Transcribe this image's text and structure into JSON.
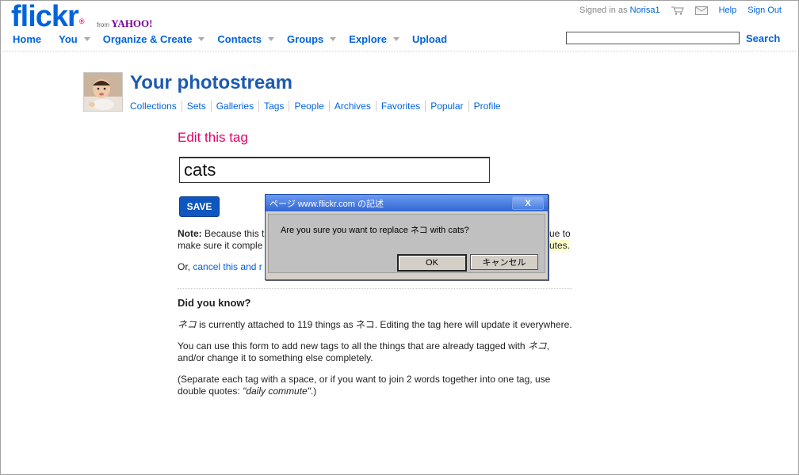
{
  "header": {
    "logo_text": "flickr",
    "logo_suffix": "from",
    "yahoo_text": "YAHOO!",
    "signed_in_as": "Signed in as",
    "username": "Norisa1",
    "help": "Help",
    "sign_out": "Sign Out",
    "nav": [
      {
        "label": "Home"
      },
      {
        "label": "You"
      },
      {
        "label": "Organize & Create"
      },
      {
        "label": "Contacts"
      },
      {
        "label": "Groups"
      },
      {
        "label": "Explore"
      },
      {
        "label": "Upload"
      }
    ],
    "search_label": "Search",
    "search_value": ""
  },
  "photostream": {
    "title": "Your photostream",
    "subnav": [
      "Collections",
      "Sets",
      "Galleries",
      "Tags",
      "People",
      "Archives",
      "Favorites",
      "Popular",
      "Profile"
    ]
  },
  "form": {
    "heading": "Edit this tag",
    "tag_value": "cats",
    "save_label": "SAVE",
    "note_label": "Note:",
    "note_text_1": "Because this t",
    "note_text_1_tail": "ue to",
    "note_text_2": "make sure it comple",
    "note_text_2_tail": "utes.",
    "or_text": "Or,",
    "cancel_link": "cancel this and r"
  },
  "didyouknow": {
    "heading": "Did you know?",
    "p1_tag": "ネコ",
    "p1_text": " is currently attached to 119 things as ",
    "p1_tag2": "ネコ",
    "p1_tail": ". Editing the tag here will update it everywhere.",
    "p2_text": "You can use this form to add new tags to all the things that are already tagged with ",
    "p2_tag": "ネコ",
    "p2_tail": ",",
    "p2_line2": "and/or change it to something else completely.",
    "p3_text": "(Separate each tag with a space, or if you want to join 2 words together into one tag, use",
    "p3_line2": "double quotes: ",
    "p3_example": "\"daily commute\"",
    "p3_tail": ".)"
  },
  "dialog": {
    "title": "ページ www.flickr.com の記述",
    "close_label": "X",
    "message": "Are you sure you want to replace ネコ with cats?",
    "ok_label": "OK",
    "cancel_label": "キャンセル"
  },
  "colors": {
    "brand_blue": "#0063dc",
    "brand_pink": "#ff0084",
    "heading_pink": "#e3006a",
    "save_blue": "#1056c0"
  }
}
